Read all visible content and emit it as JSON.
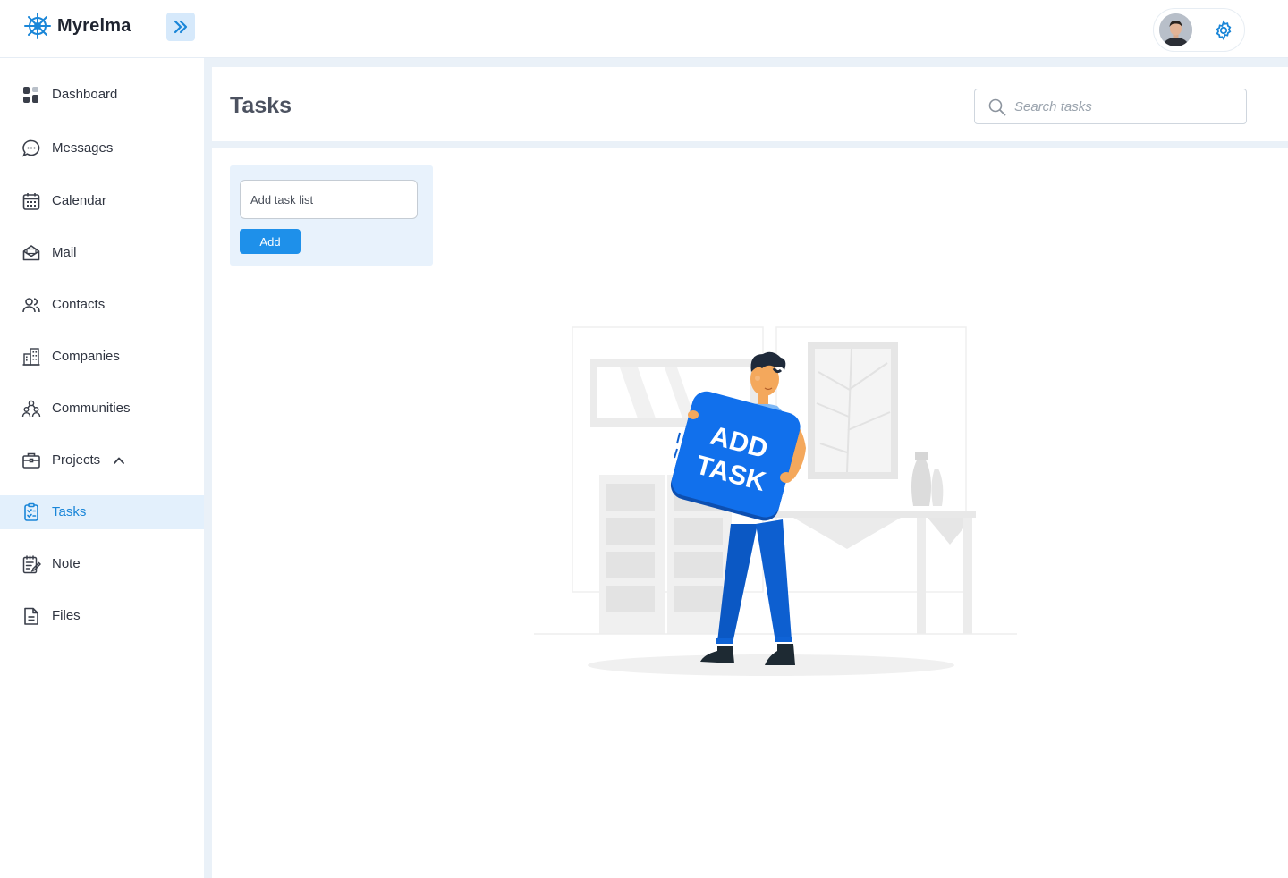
{
  "app": {
    "name": "Myrelma"
  },
  "page": {
    "title": "Tasks"
  },
  "search": {
    "placeholder": "Search tasks"
  },
  "sidebar": {
    "items": [
      {
        "label": "Dashboard",
        "icon": "dashboard-icon"
      },
      {
        "label": "Messages",
        "icon": "message-icon"
      },
      {
        "label": "Calendar",
        "icon": "calendar-icon"
      },
      {
        "label": "Mail",
        "icon": "mail-icon"
      },
      {
        "label": "Contacts",
        "icon": "contacts-icon"
      },
      {
        "label": "Companies",
        "icon": "building-icon"
      },
      {
        "label": "Communities",
        "icon": "community-icon"
      },
      {
        "label": "Projects",
        "icon": "briefcase-icon",
        "expanded": true
      },
      {
        "label": "Tasks",
        "icon": "clipboard-check-icon",
        "active": true
      },
      {
        "label": "Note",
        "icon": "note-icon"
      },
      {
        "label": "Files",
        "icon": "file-icon"
      }
    ]
  },
  "task_list": {
    "input_placeholder": "Add task list",
    "add_label": "Add"
  },
  "illustration": {
    "sign_line1": "ADD",
    "sign_line2": "TASK"
  },
  "colors": {
    "accent": "#1e90ea",
    "active_bg": "#e3f0fc",
    "active_text": "#1a86d8",
    "page_bg": "#eaf1f8"
  }
}
